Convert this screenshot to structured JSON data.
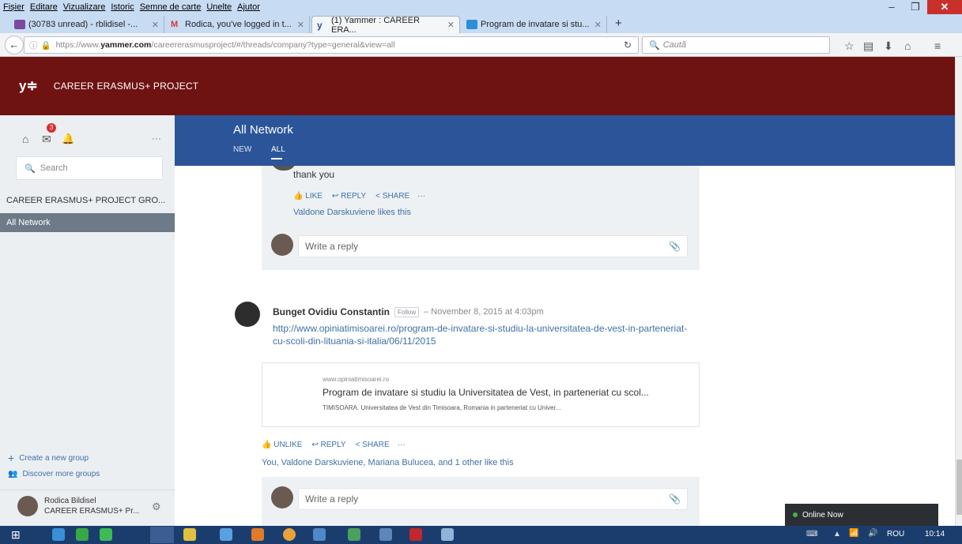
{
  "menubar": {
    "items": [
      "Fișier",
      "Editare",
      "Vizualizare",
      "Istoric",
      "Semne de carte",
      "Unelte",
      "Ajutor"
    ]
  },
  "tabs": [
    {
      "label": "(30783 unread) - rblidisel -..."
    },
    {
      "label": "Rodica, you've logged in t..."
    },
    {
      "label": "(1) Yammer : CAREER ERA..."
    },
    {
      "label": "Program de invatare si stu..."
    }
  ],
  "url": {
    "prefix": "https://www.",
    "domain": "yammer.com",
    "path": "/careererasmusproject/#/threads/company?type=general&view=all"
  },
  "search": {
    "placeholder": "Caută"
  },
  "yammer": {
    "logo": "y≑",
    "network": "CAREER ERASMUS+ PROJECT"
  },
  "sidebar": {
    "badge": "3",
    "search_placeholder": "Search",
    "items": [
      "CAREER ERASMUS+ PROJECT GRO...",
      "All Network"
    ],
    "create_group": "Create a new group",
    "discover": "Discover more groups",
    "user_name": "Rodica Bildisel",
    "user_net": "CAREER ERASMUS+ Pr..."
  },
  "header": {
    "title": "All Network",
    "tabs": [
      "NEW",
      "ALL"
    ]
  },
  "reply_thread": {
    "text": "thank you",
    "like": "LIKE",
    "reply": "REPLY",
    "share": "SHARE",
    "more": "···",
    "likes": "Valdone Darskuviene likes this",
    "write_reply": "Write a reply"
  },
  "post": {
    "author": "Bunget Ovidiu Constantin",
    "follow": "Follow",
    "date": "– November 8, 2015 at 4:03pm",
    "link": "http://www.opiniatimisoarei.ro/program-de-invatare-si-studiu-la-universitatea-de-vest-in-parteneriat-cu-scoli-din-lituania-si-italia/06/11/2015",
    "card_domain": "www.opiniatimisoarei.ro",
    "card_title": "Program de invatare si studiu la Universitatea de Vest, in parteneriat cu scol...",
    "card_desc": "TIMISOARA. Universitatea de Vest din Timisoara, Romania in parteneriat cu Univer...",
    "unlike": "UNLIKE",
    "reply": "REPLY",
    "share": "SHARE",
    "more": "···",
    "likes": "You, Valdone Darskuviene, Mariana Bulucea, and 1 other like this",
    "write_reply": "Write a reply"
  },
  "online": {
    "label": "Online Now"
  },
  "taskbar": {
    "lang": "ROU",
    "time": "10:14"
  },
  "colors": {
    "yammer_bar": "#6f1212",
    "network_bar": "#2c5499",
    "link": "#3f71a6"
  }
}
